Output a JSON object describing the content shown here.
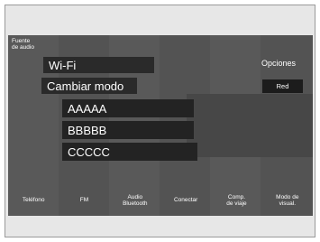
{
  "source": {
    "label": "Fuente\nde audio"
  },
  "menu": {
    "wifi": "Wi-Fi",
    "change_mode": "Cambiar modo",
    "devices": [
      "AAAAA",
      "BBBBB",
      "CCCCC"
    ]
  },
  "options": {
    "label": "Opciones",
    "network_button": "Red"
  },
  "bottom_nav": [
    {
      "label": "Teléfono"
    },
    {
      "label": "FM"
    },
    {
      "label": "Audio\nBluetooth"
    },
    {
      "label": "Conectar"
    },
    {
      "label": "Comp.\nde viaje"
    },
    {
      "label": "Modo de\nvisual."
    }
  ]
}
